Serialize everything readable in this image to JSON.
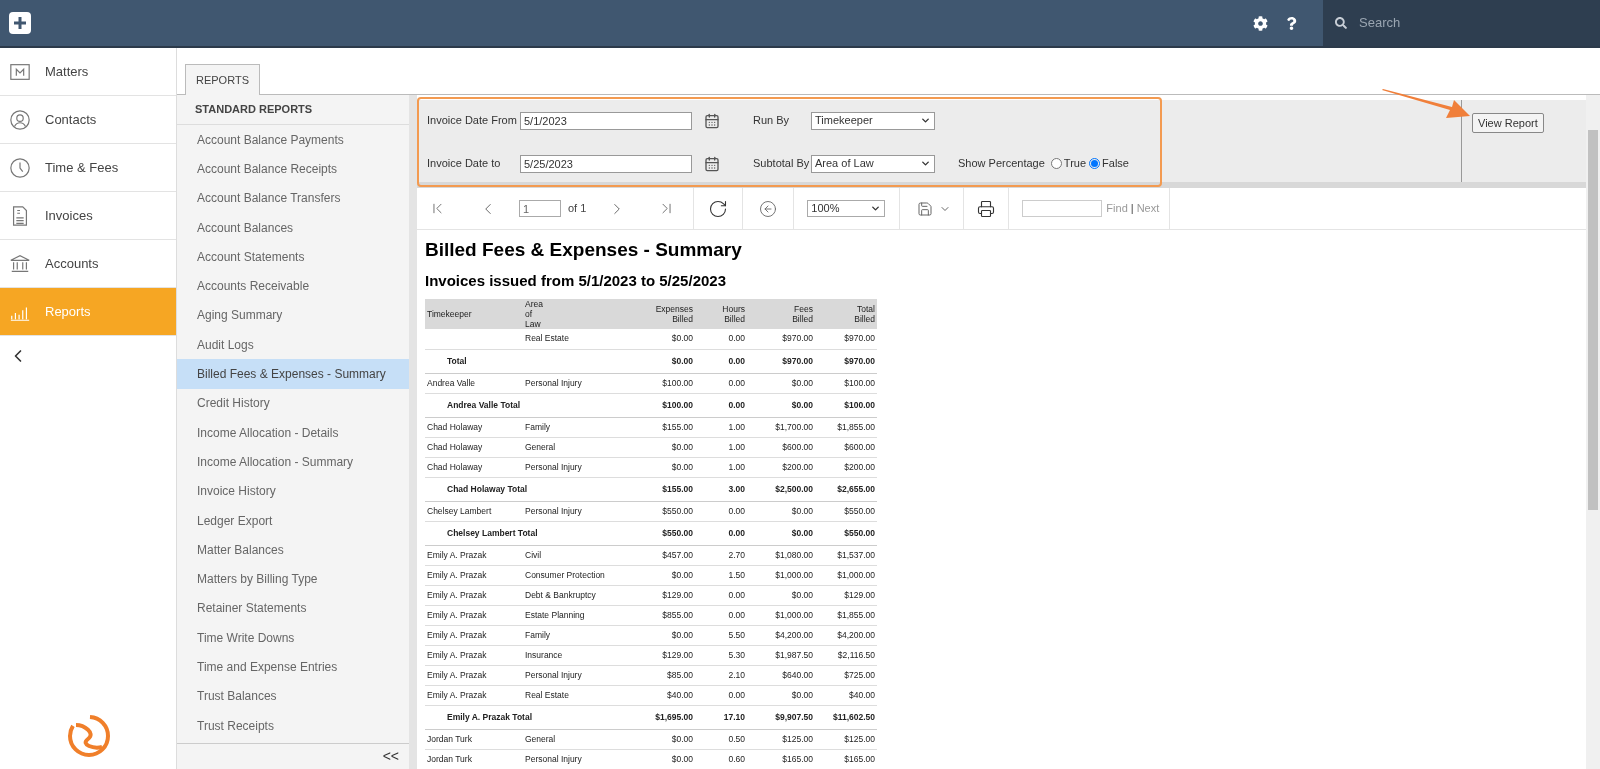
{
  "topbar": {
    "search": {
      "placeholder": "Search"
    }
  },
  "nav": [
    {
      "label": "Matters",
      "kind": "matters",
      "selected": false
    },
    {
      "label": "Contacts",
      "kind": "contacts",
      "selected": false
    },
    {
      "label": "Time & Fees",
      "kind": "time",
      "selected": false
    },
    {
      "label": "Invoices",
      "kind": "invoices",
      "selected": false
    },
    {
      "label": "Accounts",
      "kind": "accounts",
      "selected": false
    },
    {
      "label": "Reports",
      "kind": "reports",
      "selected": true
    }
  ],
  "tabs": [
    {
      "label": "REPORTS",
      "selected": true
    }
  ],
  "reports_panel": {
    "heading": "STANDARD REPORTS",
    "collapse": "<<",
    "items": [
      {
        "label": "Account Balance Payments",
        "selected": false
      },
      {
        "label": "Account Balance Receipts",
        "selected": false
      },
      {
        "label": "Account Balance Transfers",
        "selected": false
      },
      {
        "label": "Account Balances",
        "selected": false
      },
      {
        "label": "Account Statements",
        "selected": false
      },
      {
        "label": "Accounts Receivable",
        "selected": false
      },
      {
        "label": "Aging Summary",
        "selected": false
      },
      {
        "label": "Audit Logs",
        "selected": false
      },
      {
        "label": "Billed Fees & Expenses - Summary",
        "selected": true
      },
      {
        "label": "Credit History",
        "selected": false
      },
      {
        "label": "Income Allocation - Details",
        "selected": false
      },
      {
        "label": "Income Allocation - Summary",
        "selected": false
      },
      {
        "label": "Invoice History",
        "selected": false
      },
      {
        "label": "Ledger Export",
        "selected": false
      },
      {
        "label": "Matter Balances",
        "selected": false
      },
      {
        "label": "Matters by Billing Type",
        "selected": false
      },
      {
        "label": "Retainer Statements",
        "selected": false
      },
      {
        "label": "Time Write Downs",
        "selected": false
      },
      {
        "label": "Time and Expense Entries",
        "selected": false
      },
      {
        "label": "Trust Balances",
        "selected": false
      },
      {
        "label": "Trust Receipts",
        "selected": false
      }
    ]
  },
  "parameters": {
    "date_from": {
      "label": "Invoice Date From",
      "value": "5/1/2023"
    },
    "date_to": {
      "label": "Invoice Date to",
      "value": "5/25/2023"
    },
    "run_by": {
      "label": "Run By",
      "value": "Timekeeper"
    },
    "subtotal_by": {
      "label": "Subtotal By",
      "value": "Area of Law"
    },
    "show_percentage": {
      "label": "Show Percentage",
      "options": [
        {
          "label": "True",
          "selected": false
        },
        {
          "label": "False",
          "selected": true
        }
      ]
    },
    "view_button": "View Report"
  },
  "toolbar": {
    "page": "1",
    "of": "of 1",
    "zoom": "100%",
    "find": "Find",
    "separator": "|",
    "next": "Next"
  },
  "report": {
    "title": "Billed Fees & Expenses - Summary",
    "subtitle": "Invoices issued from 5/1/2023 to 5/25/2023",
    "columns": [
      "Timekeeper",
      "Area of Law",
      "Expenses Billed",
      "Hours Billed",
      "Fees Billed",
      "Total Billed"
    ],
    "rows": [
      {
        "kind": "detail",
        "cells": [
          "",
          "Real Estate",
          "$0.00",
          "0.00",
          "$970.00",
          "$970.00"
        ]
      },
      {
        "kind": "total",
        "cells": [
          "Total",
          "",
          "$0.00",
          "0.00",
          "$970.00",
          "$970.00"
        ]
      },
      {
        "kind": "detail",
        "cells": [
          "Andrea Valle",
          "Personal Injury",
          "$100.00",
          "0.00",
          "$0.00",
          "$100.00"
        ]
      },
      {
        "kind": "total",
        "cells": [
          "Andrea Valle Total",
          "",
          "$100.00",
          "0.00",
          "$0.00",
          "$100.00"
        ]
      },
      {
        "kind": "detail",
        "cells": [
          "Chad Holaway",
          "Family",
          "$155.00",
          "1.00",
          "$1,700.00",
          "$1,855.00"
        ]
      },
      {
        "kind": "detail",
        "cells": [
          "Chad Holaway",
          "General",
          "$0.00",
          "1.00",
          "$600.00",
          "$600.00"
        ]
      },
      {
        "kind": "detail",
        "cells": [
          "Chad Holaway",
          "Personal Injury",
          "$0.00",
          "1.00",
          "$200.00",
          "$200.00"
        ]
      },
      {
        "kind": "total",
        "cells": [
          "Chad Holaway Total",
          "",
          "$155.00",
          "3.00",
          "$2,500.00",
          "$2,655.00"
        ]
      },
      {
        "kind": "detail",
        "cells": [
          "Chelsey Lambert",
          "Personal Injury",
          "$550.00",
          "0.00",
          "$0.00",
          "$550.00"
        ]
      },
      {
        "kind": "total",
        "cells": [
          "Chelsey Lambert Total",
          "",
          "$550.00",
          "0.00",
          "$0.00",
          "$550.00"
        ]
      },
      {
        "kind": "detail",
        "cells": [
          "Emily A. Prazak",
          "Civil",
          "$457.00",
          "2.70",
          "$1,080.00",
          "$1,537.00"
        ]
      },
      {
        "kind": "detail",
        "cells": [
          "Emily A. Prazak",
          "Consumer Protection",
          "$0.00",
          "1.50",
          "$1,000.00",
          "$1,000.00"
        ]
      },
      {
        "kind": "detail",
        "cells": [
          "Emily A. Prazak",
          "Debt & Bankruptcy",
          "$129.00",
          "0.00",
          "$0.00",
          "$129.00"
        ]
      },
      {
        "kind": "detail",
        "cells": [
          "Emily A. Prazak",
          "Estate Planning",
          "$855.00",
          "0.00",
          "$1,000.00",
          "$1,855.00"
        ]
      },
      {
        "kind": "detail",
        "cells": [
          "Emily A. Prazak",
          "Family",
          "$0.00",
          "5.50",
          "$4,200.00",
          "$4,200.00"
        ]
      },
      {
        "kind": "detail",
        "cells": [
          "Emily A. Prazak",
          "Insurance",
          "$129.00",
          "5.30",
          "$1,987.50",
          "$2,116.50"
        ]
      },
      {
        "kind": "detail",
        "cells": [
          "Emily A. Prazak",
          "Personal Injury",
          "$85.00",
          "2.10",
          "$640.00",
          "$725.00"
        ]
      },
      {
        "kind": "detail",
        "cells": [
          "Emily A. Prazak",
          "Real Estate",
          "$40.00",
          "0.00",
          "$0.00",
          "$40.00"
        ]
      },
      {
        "kind": "total",
        "cells": [
          "Emily A. Prazak Total",
          "",
          "$1,695.00",
          "17.10",
          "$9,907.50",
          "$11,602.50"
        ]
      },
      {
        "kind": "detail",
        "cells": [
          "Jordan Turk",
          "General",
          "$0.00",
          "0.50",
          "$125.00",
          "$125.00"
        ]
      },
      {
        "kind": "detail",
        "cells": [
          "Jordan Turk",
          "Personal Injury",
          "$0.00",
          "0.60",
          "$165.00",
          "$165.00"
        ]
      }
    ]
  }
}
